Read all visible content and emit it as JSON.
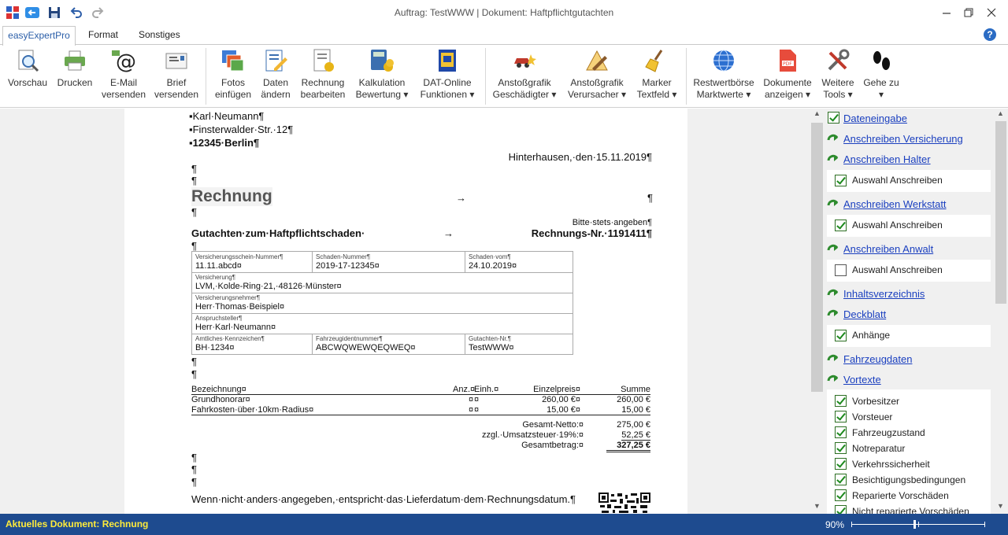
{
  "window": {
    "title": "Auftrag: TestWWW | Dokument: Haftpflichtgutachten"
  },
  "tabs": [
    "easyExpertPro",
    "Format",
    "Sonstiges"
  ],
  "ribbon": [
    {
      "label1": "Vorschau",
      "label2": "",
      "icon": "preview-icon"
    },
    {
      "label1": "Drucken",
      "label2": "",
      "icon": "printer-icon"
    },
    {
      "label1": "E-Mail",
      "label2": "versenden",
      "icon": "email-icon"
    },
    {
      "label1": "Brief",
      "label2": "versenden",
      "icon": "letter-icon"
    },
    {
      "label1": "Fotos",
      "label2": "einfügen",
      "icon": "photos-icon"
    },
    {
      "label1": "Daten",
      "label2": "ändern",
      "icon": "edit-data-icon"
    },
    {
      "label1": "Rechnung",
      "label2": "bearbeiten",
      "icon": "invoice-icon"
    },
    {
      "label1": "Kalkulation",
      "label2": "Bewertung ▾",
      "icon": "calculator-icon"
    },
    {
      "label1": "DAT-Online",
      "label2": "Funktionen ▾",
      "icon": "dat-icon"
    },
    {
      "label1": "Anstoßgrafik",
      "label2": "Geschädigter ▾",
      "icon": "crash-car-icon"
    },
    {
      "label1": "Anstoßgrafik",
      "label2": "Verursacher ▾",
      "icon": "drawing-icon"
    },
    {
      "label1": "Marker",
      "label2": "Textfeld ▾",
      "icon": "broom-icon"
    },
    {
      "label1": "Restwertbörse",
      "label2": "Marktwerte ▾",
      "icon": "globe-icon"
    },
    {
      "label1": "Dokumente",
      "label2": "anzeigen ▾",
      "icon": "pdf-icon"
    },
    {
      "label1": "Weitere",
      "label2": "Tools ▾",
      "icon": "tools-icon"
    },
    {
      "label1": "Gehe zu",
      "label2": "▾",
      "icon": "footprints-icon"
    }
  ],
  "doc": {
    "addr1": "▪Karl·Neumann¶",
    "addr2": "▪Finsterwalder·Str.·12¶",
    "addr3": "▪12345·Berlin¶",
    "date": "Hinterhausen,·den·15.11.2019¶",
    "para": "¶",
    "title": "Rechnung",
    "arrow": "→",
    "bitte": "Bitte·stets·angeben¶",
    "subject": "Gutachten·zum·Haftpflichtschaden·",
    "invno": "Rechnungs-Nr.·1191411¶",
    "meta": {
      "vsn_label": "Versicherungsschein-Nummer¶",
      "vsn": "11.11.abcd¤",
      "sn_label": "Schaden-Nummer¶",
      "sn": "2019-17-12345¤",
      "sv_label": "Schaden·vom¶",
      "sv": "24.10.2019¤",
      "vers_label": "Versicherung¶",
      "vers": "LVM,·Kolde-Ring·21,·48126·Münster¤",
      "vn_label": "Versicherungsnehmer¶",
      "vn": "Herr·Thomas·Beispiel¤",
      "as_label": "Anspruchsteller¶",
      "as": "Herr·Karl·Neumann¤",
      "kz_label": "Amtliches·Kennzeichen¶",
      "kz": "BH·1234¤",
      "fin_label": "Fahrzeugidentnummer¶",
      "fin": "ABCWQWEWQEQWEQ¤",
      "gn_label": "Gutachten-Nr.¶",
      "gn": "TestWWW¤"
    },
    "items_header": {
      "bez": "Bezeichnung¤",
      "anz": "Anz.¤",
      "einh": "Einh.¤",
      "ep": "Einzelpreis¤",
      "summe": "Summe"
    },
    "items": [
      {
        "bez": "Grundhonorar¤",
        "anz": "¤",
        "einh": "¤",
        "ep": "260,00 €¤",
        "summe": "260,00 €"
      },
      {
        "bez": "Fahrkosten·über·10km·Radius¤",
        "anz": "¤",
        "einh": "¤",
        "ep": "15,00 €¤",
        "summe": "15,00 €"
      }
    ],
    "totals": [
      {
        "label": "Gesamt-Netto:¤",
        "value": "275,00 €"
      },
      {
        "label": "zzgl.·Umsatzsteuer·19%:¤",
        "value": "52,25 €"
      },
      {
        "label": "Gesamtbetrag:¤",
        "value": "327,25 €"
      }
    ],
    "footer": "Wenn·nicht·anders·angegeben,·entspricht·das·Lieferdatum·dem·Rechnungsdatum.¶"
  },
  "panel": [
    {
      "type": "check",
      "text": "Dateneingabe",
      "link": true
    },
    {
      "type": "go",
      "text": "Anschreiben Versicherung",
      "link": true
    },
    {
      "type": "go",
      "text": "Anschreiben Halter",
      "link": true
    },
    {
      "type": "subcheck",
      "text": "Auswahl Anschreiben",
      "checked": true
    },
    {
      "type": "go",
      "text": "Anschreiben Werkstatt",
      "link": true
    },
    {
      "type": "subcheck",
      "text": "Auswahl Anschreiben",
      "checked": true
    },
    {
      "type": "go",
      "text": "Anschreiben Anwalt",
      "link": true
    },
    {
      "type": "subcheck",
      "text": "Auswahl Anschreiben",
      "checked": false
    },
    {
      "type": "go",
      "text": "Inhaltsverzeichnis",
      "link": true
    },
    {
      "type": "go",
      "text": "Deckblatt",
      "link": true
    },
    {
      "type": "subcheck",
      "text": "Anhänge",
      "checked": true
    },
    {
      "type": "go",
      "text": "Fahrzeugdaten",
      "link": true
    },
    {
      "type": "go",
      "text": "Vortexte",
      "link": true
    },
    {
      "type": "list",
      "items": [
        "Vorbesitzer",
        "Vorsteuer",
        "Fahrzeugzustand",
        "Notreparatur",
        "Verkehrssicherheit",
        "Besichtigungsbedingungen",
        "Reparierte Vorschäden",
        "Nicht reparierte Vorschäden"
      ]
    }
  ],
  "status": {
    "left": "Aktuelles Dokument: Rechnung",
    "zoom": "90%"
  }
}
